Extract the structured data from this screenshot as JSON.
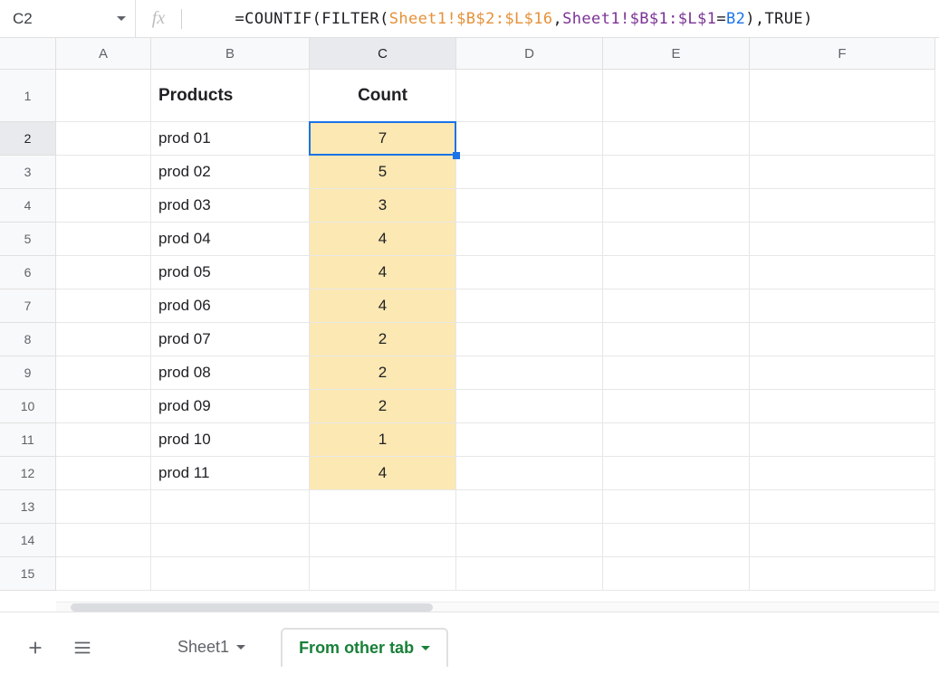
{
  "nameBox": {
    "ref": "C2"
  },
  "formula": {
    "p1": "=COUNTIF(FILTER(",
    "r1": "Sheet1!$B$2:$L$16",
    "c1": ",",
    "r2": "Sheet1!$B$1:$L$1",
    "eq": "=",
    "r3": "B2",
    "p2": "),",
    "tr": "TRUE",
    "p3": ")"
  },
  "columns": [
    "A",
    "B",
    "C",
    "D",
    "E",
    "F"
  ],
  "rowCount": 15,
  "activeCell": {
    "row": 2,
    "col": "C"
  },
  "headers": {
    "b": "Products",
    "c": "Count"
  },
  "data": [
    {
      "b": "prod 01",
      "c": "7"
    },
    {
      "b": "prod 02",
      "c": "5"
    },
    {
      "b": "prod 03",
      "c": "3"
    },
    {
      "b": "prod 04",
      "c": "4"
    },
    {
      "b": "prod 05",
      "c": "4"
    },
    {
      "b": "prod 06",
      "c": "4"
    },
    {
      "b": "prod 07",
      "c": "2"
    },
    {
      "b": "prod 08",
      "c": "2"
    },
    {
      "b": "prod 09",
      "c": "2"
    },
    {
      "b": "prod 10",
      "c": "1"
    },
    {
      "b": "prod 11",
      "c": "4"
    }
  ],
  "tabs": {
    "sheet1": "Sheet1",
    "active": "From other tab"
  }
}
